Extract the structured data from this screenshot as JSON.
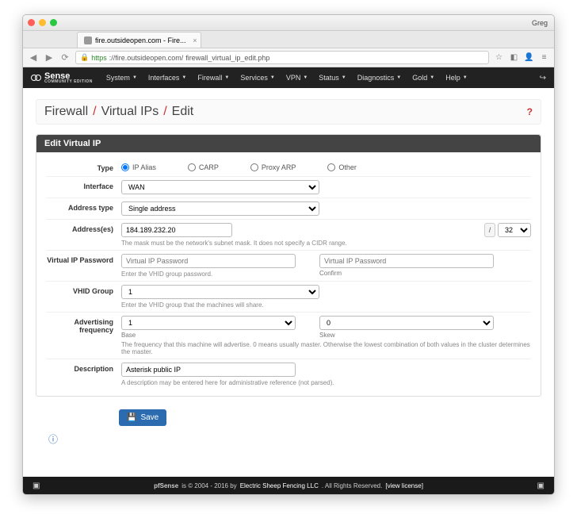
{
  "window": {
    "user": "Greg"
  },
  "tab": {
    "title": "fire.outsideopen.com - Fire..."
  },
  "url": {
    "https": "https",
    "host": "://fire.outsideopen.com/",
    "path": "firewall_virtual_ip_edit.php"
  },
  "brand": {
    "name": "Sense",
    "sub": "COMMUNITY EDITION"
  },
  "nav": {
    "items": [
      "System",
      "Interfaces",
      "Firewall",
      "Services",
      "VPN",
      "Status",
      "Diagnostics",
      "Gold",
      "Help"
    ]
  },
  "breadcrumb": {
    "a": "Firewall",
    "b": "Virtual IPs",
    "c": "Edit"
  },
  "panel": {
    "title": "Edit Virtual IP"
  },
  "labels": {
    "type": "Type",
    "interface": "Interface",
    "addrtype": "Address type",
    "addresses": "Address(es)",
    "vippw": "Virtual IP Password",
    "vhid": "VHID Group",
    "advfreq": "Advertising frequency",
    "desc": "Description"
  },
  "type": {
    "opt1": "IP Alias",
    "opt2": "CARP",
    "opt3": "Proxy ARP",
    "opt4": "Other"
  },
  "interface": {
    "value": "WAN"
  },
  "addrtype": {
    "value": "Single address"
  },
  "address": {
    "value": "184.189.232.20",
    "mask": "32",
    "help": "The mask must be the network's subnet mask. It does not specify a CIDR range."
  },
  "vippw": {
    "ph1": "Virtual IP Password",
    "ph2": "Virtual IP Password",
    "help": "Enter the VHID group password.",
    "confirm": "Confirm"
  },
  "vhid": {
    "value": "1",
    "help": "Enter the VHID group that the machines will share."
  },
  "advfreq": {
    "base": "1",
    "skew": "0",
    "base_lbl": "Base",
    "skew_lbl": "Skew",
    "help": "The frequency that this machine will advertise. 0 means usually master. Otherwise the lowest combination of both values in the cluster determines the master."
  },
  "desc": {
    "value": "Asterisk public IP",
    "help": "A description may be entered here for administrative reference (not parsed)."
  },
  "save": "Save",
  "footer": {
    "product": "pfSense",
    "mid": " is © 2004 - 2016 by ",
    "company": "Electric Sheep Fencing LLC",
    "tail": ". All Rights Reserved. ",
    "license": "[view license]"
  }
}
